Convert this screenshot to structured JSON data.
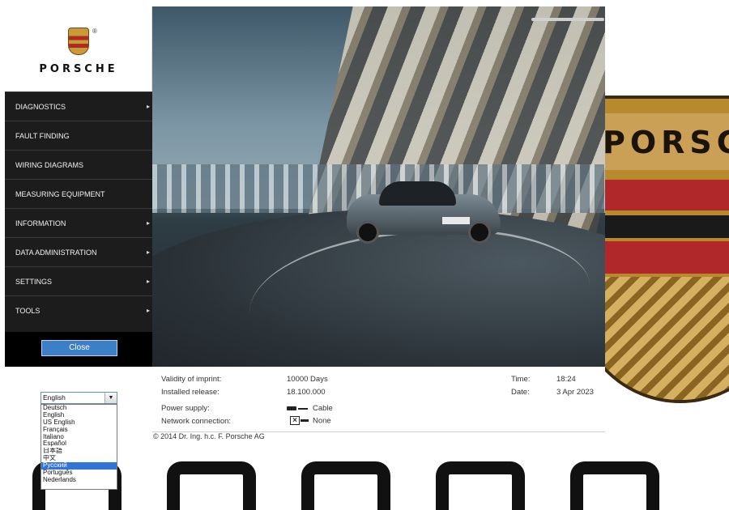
{
  "brand": {
    "wordmark": "PORSCHE",
    "registered": "®"
  },
  "menu": [
    {
      "label": "DIAGNOSTICS",
      "has_submenu": true
    },
    {
      "label": "FAULT FINDING",
      "has_submenu": false
    },
    {
      "label": "WIRING DIAGRAMS",
      "has_submenu": false
    },
    {
      "label": "MEASURING EQUIPMENT",
      "has_submenu": false
    },
    {
      "label": "INFORMATION",
      "has_submenu": true
    },
    {
      "label": "DATA ADMINISTRATION",
      "has_submenu": true
    },
    {
      "label": "SETTINGS",
      "has_submenu": true
    },
    {
      "label": "TOOLS",
      "has_submenu": true
    }
  ],
  "submenu_arrow": "▸",
  "close_button": "Close",
  "info": {
    "validity_label": "Validity of imprint:",
    "validity_value": "10000 Days",
    "release_label": "Installed release:",
    "release_value": "18.100.000",
    "power_label": "Power supply:",
    "power_value": "Cable",
    "network_label": "Network connection:",
    "network_value": "None",
    "time_label": "Time:",
    "time_value": "18:24",
    "date_label": "Date:",
    "date_value": "3 Apr 2023"
  },
  "copyright": "© 2014 Dr. Ing. h.c. F. Porsche AG",
  "language": {
    "selected": "English",
    "options": [
      "Deutsch",
      "English",
      "US English",
      "Français",
      "Italiano",
      "Español",
      "日本語",
      "中文",
      "Русский",
      "Português",
      "Nederlands"
    ],
    "highlighted": "Русский"
  },
  "hero": {
    "plate": "S-CY 758"
  },
  "colors": {
    "sidebar_bg": "#1c1c1c",
    "accent_blue": "#3d7fc7",
    "selection_blue": "#3173d6"
  }
}
